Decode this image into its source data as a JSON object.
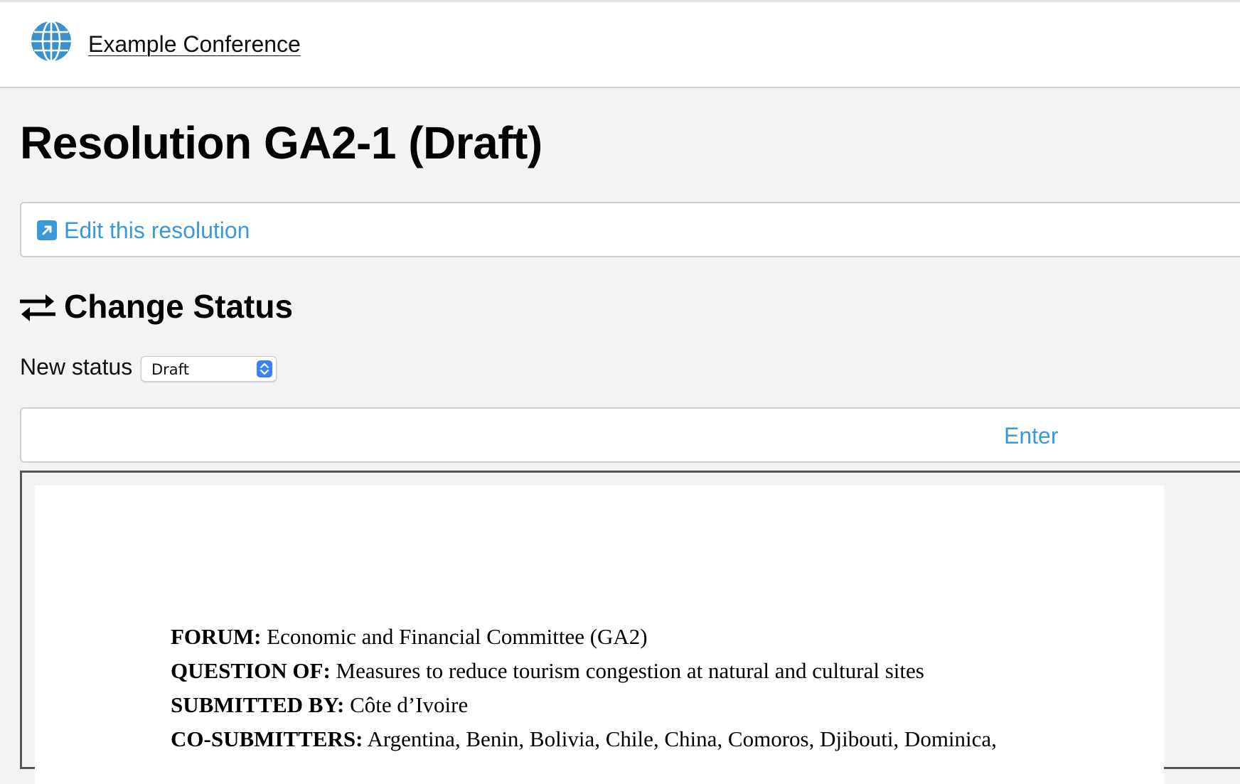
{
  "header": {
    "site_title": "Example Conference"
  },
  "page": {
    "title": "Resolution GA2-1 (Draft)"
  },
  "edit": {
    "label": "Edit this resolution"
  },
  "change_status": {
    "heading": "Change Status",
    "new_status_label": "New status",
    "selected_status": "Draft",
    "submit_label": "Enter"
  },
  "document": {
    "lines": [
      {
        "key": "FORUM:",
        "value": "Economic and Financial Committee (GA2)"
      },
      {
        "key": "QUESTION OF:",
        "value": "Measures to reduce tourism congestion at natural and cultural sites"
      },
      {
        "key": "SUBMITTED BY:",
        "value": "Côte d’Ivoire"
      },
      {
        "key": "CO-SUBMITTERS:",
        "value": "Argentina, Benin, Bolivia, Chile, China, Comoros, Djibouti, Dominica,"
      }
    ]
  },
  "colors": {
    "link": "#3a9ad9",
    "globe": "#3a8fd0",
    "select_accent": "#3b82f6"
  },
  "icons": {
    "logo": "globe-icon",
    "edit": "external-link-icon",
    "change_status": "swap-arrows-icon",
    "select": "chevron-updown-icon"
  }
}
